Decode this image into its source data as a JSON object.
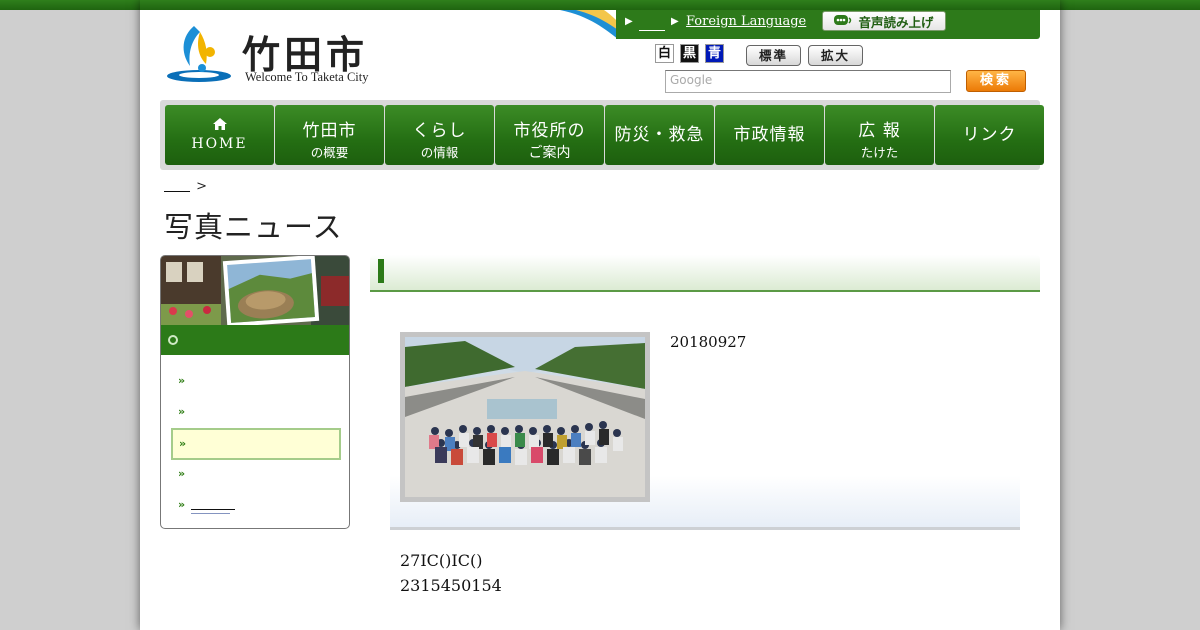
{
  "site": {
    "title": "竹田市",
    "subtitle": "Welcome To Taketa City"
  },
  "utility": {
    "link1": "＿＿",
    "foreign_language": "Foreign Language",
    "voice_button": "音声読み上げ"
  },
  "colors": {
    "white_label": "白",
    "black_label": "黒",
    "blue_label": "青",
    "brand_green": "#2c7a18",
    "accent_orange": "#ec7a06"
  },
  "text_size": {
    "standard": "標準",
    "large": "拡大"
  },
  "search": {
    "placeholder": "Google",
    "button": "検索"
  },
  "nav": {
    "home": "HOME",
    "overview_l1": "竹田市",
    "overview_l2": "の概要",
    "life_l1": "くらし",
    "life_l2": "の情報",
    "office_l1": "市役所の",
    "office_l2": "ご案内",
    "disaster": "防災・救急",
    "politics": "市政情報",
    "pr_l1": "広 報",
    "pr_l2": "たけた",
    "links": "リンク"
  },
  "breadcrumb": {
    "home_link": "＿＿",
    "separator": ">"
  },
  "page_title": "写真ニュース",
  "article": {
    "date": "20180927",
    "line1": "27IC()IC()",
    "line2": "2315450154"
  },
  "side_menu": {
    "item5_link": "＿＿＿"
  }
}
